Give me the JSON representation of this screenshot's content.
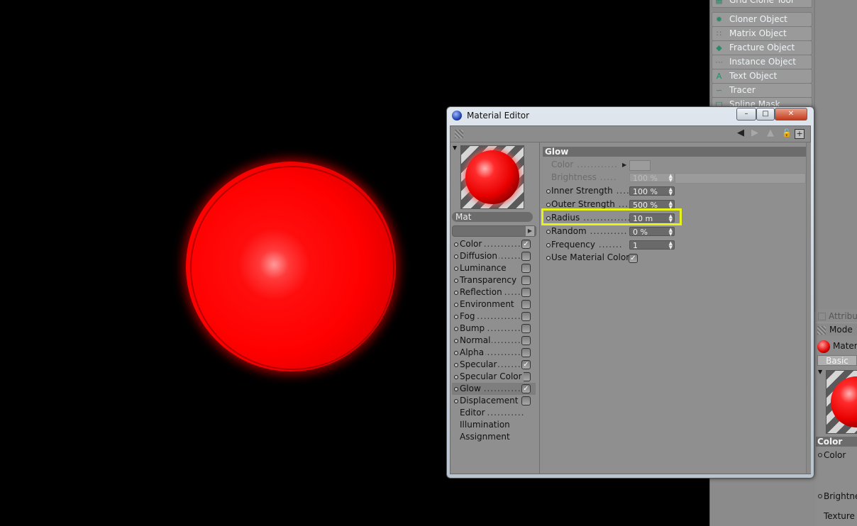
{
  "object_list": {
    "items": [
      {
        "label": "Grid Clone Tool",
        "icon": "clone-icon"
      },
      {
        "label": "Cloner Object",
        "icon": "cloner-icon"
      },
      {
        "label": "Matrix Object",
        "icon": "matrix-icon"
      },
      {
        "label": "Fracture Object",
        "icon": "fracture-icon"
      },
      {
        "label": "Instance Object",
        "icon": "instance-icon"
      },
      {
        "label": "Text Object",
        "icon": "text-object-icon"
      },
      {
        "label": "Tracer",
        "icon": "tracer-icon"
      },
      {
        "label": "Spline Mask",
        "icon": "spline-mask-icon"
      }
    ]
  },
  "attributes_panel": {
    "title": "Attribu",
    "mode_label": "Mode",
    "material_label": "Mater",
    "basic_tab": "Basic",
    "section": "Color",
    "color_label": "Color",
    "brightness_label": "Brightne",
    "texture_label": "Texture"
  },
  "material_editor": {
    "title": "Material Editor",
    "window_buttons": {
      "minimize": "–",
      "maximize": "□",
      "close": "✕"
    },
    "material_name": "Mat",
    "channels": [
      {
        "label": "Color",
        "has_checkbox": true,
        "checked": true
      },
      {
        "label": "Diffusion",
        "has_checkbox": true,
        "checked": false
      },
      {
        "label": "Luminance",
        "has_checkbox": true,
        "checked": false
      },
      {
        "label": "Transparency",
        "has_checkbox": true,
        "checked": false
      },
      {
        "label": "Reflection",
        "has_checkbox": true,
        "checked": false
      },
      {
        "label": "Environment",
        "has_checkbox": true,
        "checked": false
      },
      {
        "label": "Fog",
        "has_checkbox": true,
        "checked": false
      },
      {
        "label": "Bump",
        "has_checkbox": true,
        "checked": false
      },
      {
        "label": "Normal",
        "has_checkbox": true,
        "checked": false
      },
      {
        "label": "Alpha",
        "has_checkbox": true,
        "checked": false
      },
      {
        "label": "Specular",
        "has_checkbox": true,
        "checked": true
      },
      {
        "label": "Specular Color",
        "has_checkbox": true,
        "checked": false
      },
      {
        "label": "Glow",
        "has_checkbox": true,
        "checked": true,
        "selected": true
      },
      {
        "label": "Displacement",
        "has_checkbox": true,
        "checked": false
      },
      {
        "label": "Editor",
        "has_checkbox": false
      },
      {
        "label": "Illumination",
        "has_checkbox": false
      },
      {
        "label": "Assignment",
        "has_checkbox": false
      }
    ],
    "glow": {
      "header": "Glow",
      "params": [
        {
          "label": "Color",
          "value": "",
          "disabled": true
        },
        {
          "label": "Brightness",
          "value": "100 %",
          "disabled": true
        },
        {
          "label": "Inner Strength",
          "value": "100 %"
        },
        {
          "label": "Outer Strength",
          "value": "500 %"
        },
        {
          "label": "Radius",
          "value": "10 m",
          "highlighted": true
        },
        {
          "label": "Random",
          "value": "0 %"
        },
        {
          "label": "Frequency",
          "value": "1"
        }
      ],
      "use_material_color": {
        "label": "Use Material Color",
        "checked": true
      }
    }
  },
  "colors": {
    "highlight": "#e6f21a",
    "sphere": "#ff0000",
    "viewport_bg": "#000000",
    "panel_bg": "#8f8f8f"
  }
}
